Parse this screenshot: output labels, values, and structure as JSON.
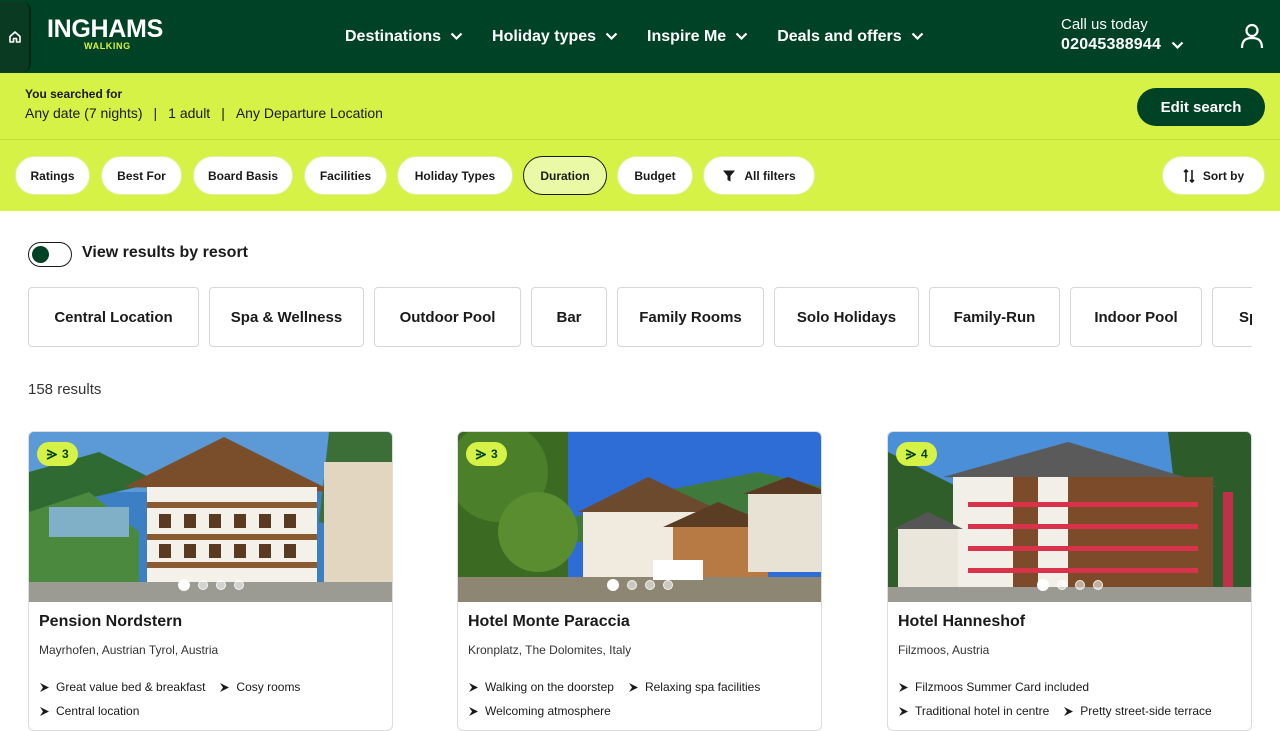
{
  "header": {
    "logo_main": "INGHAMS",
    "logo_sub": "WALKING",
    "nav": [
      {
        "label": "Destinations"
      },
      {
        "label": "Holiday types"
      },
      {
        "label": "Inspire Me"
      },
      {
        "label": "Deals and offers"
      }
    ],
    "call_label": "Call us today",
    "phone": "02045388944"
  },
  "search_summary": {
    "label": "You searched for",
    "date": "Any date (7 nights)",
    "travellers": "1 adult",
    "departure": "Any Departure Location",
    "separator": "|",
    "edit_label": "Edit search"
  },
  "filters": {
    "pills": [
      "Ratings",
      "Best For",
      "Board Basis",
      "Facilities",
      "Holiday Types",
      "Duration",
      "Budget"
    ],
    "all_filters": "All filters",
    "sort_by": "Sort by",
    "active": "Duration"
  },
  "view_by_resort": {
    "label": "View results by resort",
    "enabled": false
  },
  "facility_chips": [
    "Central Location",
    "Spa & Wellness",
    "Outdoor Pool",
    "Bar",
    "Family Rooms",
    "Solo Holidays",
    "Family-Run",
    "Indoor Pool",
    "Sp"
  ],
  "results": {
    "count_text": "158 results",
    "cards": [
      {
        "rating": "3",
        "title": "Pension Nordstern",
        "location": "Mayrhofen, Austrian Tyrol, Austria",
        "features": [
          "Great value bed & breakfast",
          "Cosy rooms",
          "Central location"
        ],
        "image_dots": 4,
        "active_dot": 0
      },
      {
        "rating": "3",
        "title": "Hotel Monte Paraccia",
        "location": "Kronplatz, The Dolomites, Italy",
        "features": [
          "Walking on the doorstep",
          "Relaxing spa facilities",
          "Welcoming atmosphere"
        ],
        "image_dots": 4,
        "active_dot": 0
      },
      {
        "rating": "4",
        "title": "Hotel Hanneshof",
        "location": "Filzmoos, Austria",
        "features": [
          "Filzmoos Summer Card included",
          "Traditional hotel in centre",
          "Pretty street-side terrace"
        ],
        "image_dots": 4,
        "active_dot": 0
      }
    ]
  },
  "colors": {
    "brand_green": "#004225",
    "lime": "#d6f246"
  }
}
